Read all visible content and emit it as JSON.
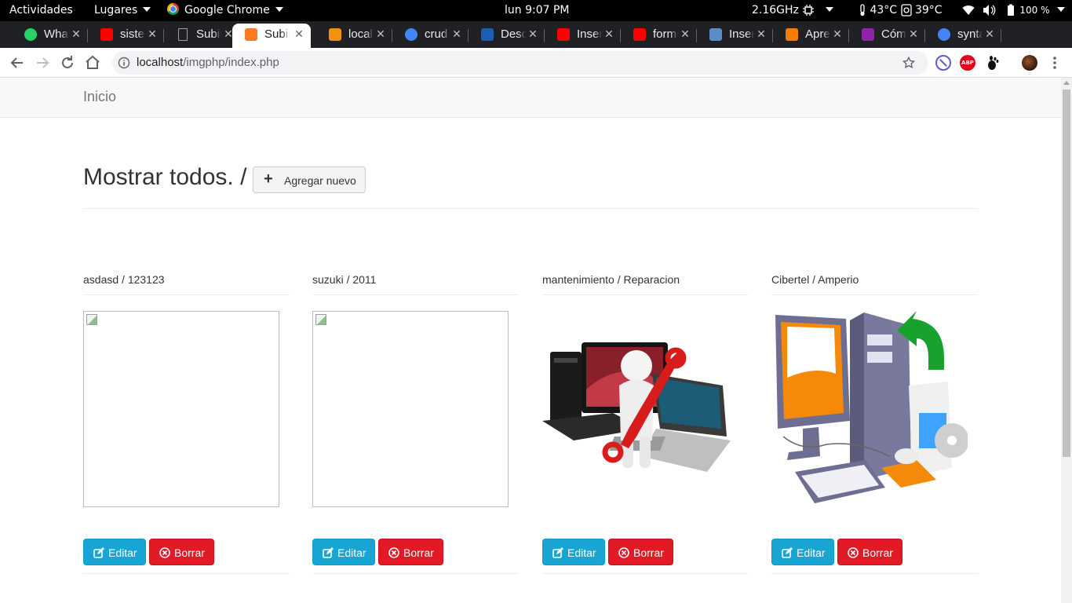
{
  "topbar": {
    "activities": "Actividades",
    "places": "Lugares",
    "app_name": "Google Chrome",
    "clock": "lun  9:07 PM",
    "cpu_freq": "2.16GHz",
    "temp_cpu": "43°C",
    "temp_hdd": "39°C",
    "battery": "100 %"
  },
  "tabs": [
    {
      "title": "WhatsApp",
      "favicon": "whatsapp-icon",
      "color": "#25d366",
      "active": false
    },
    {
      "title": "sistema",
      "favicon": "youtube-icon",
      "color": "#ff0000",
      "active": false
    },
    {
      "title": "Subir",
      "favicon": "page-icon",
      "color": "#9aa0a6",
      "active": false
    },
    {
      "title": "Subir",
      "favicon": "xampp-icon",
      "color": "#fb7a24",
      "active": true
    },
    {
      "title": "localhost",
      "favicon": "phpmyadmin-icon",
      "color": "#f29111",
      "active": false
    },
    {
      "title": "crud",
      "favicon": "google-icon",
      "color": "#4285f4",
      "active": false
    },
    {
      "title": "Descargar",
      "favicon": "bp-icon",
      "color": "#1a5fb4",
      "active": false
    },
    {
      "title": "Insertar",
      "favicon": "youtube-icon",
      "color": "#ff0000",
      "active": false
    },
    {
      "title": "formulario",
      "favicon": "youtube-icon",
      "color": "#ff0000",
      "active": false
    },
    {
      "title": "Insertar",
      "favicon": "stack-icon",
      "color": "#5a8dc7",
      "active": false
    },
    {
      "title": "Aprende",
      "favicon": "blogger-icon",
      "color": "#f57d00",
      "active": false
    },
    {
      "title": "Cómo",
      "favicon": "hashnode-icon",
      "color": "#8e24aa",
      "active": false
    },
    {
      "title": "syntax",
      "favicon": "google-icon",
      "color": "#4285f4",
      "active": false
    }
  ],
  "address": {
    "host": "localhost",
    "path": "/imgphp/index.php"
  },
  "page": {
    "brand": "Inicio",
    "heading": "Mostrar todos. /",
    "add_button": "Agregar nuevo",
    "edit_label": "Editar",
    "delete_label": "Borrar",
    "colors": {
      "edit": "#18a5d4",
      "delete": "#e11a26"
    }
  },
  "cards": [
    {
      "title": "asdasd / 123123",
      "image": "broken"
    },
    {
      "title": "suzuki / 2011",
      "image": "broken"
    },
    {
      "title": "mantenimiento / Reparacion",
      "image": "repair-illustration"
    },
    {
      "title": "Cibertel / Amperio",
      "image": "computer-install-illustration"
    }
  ]
}
